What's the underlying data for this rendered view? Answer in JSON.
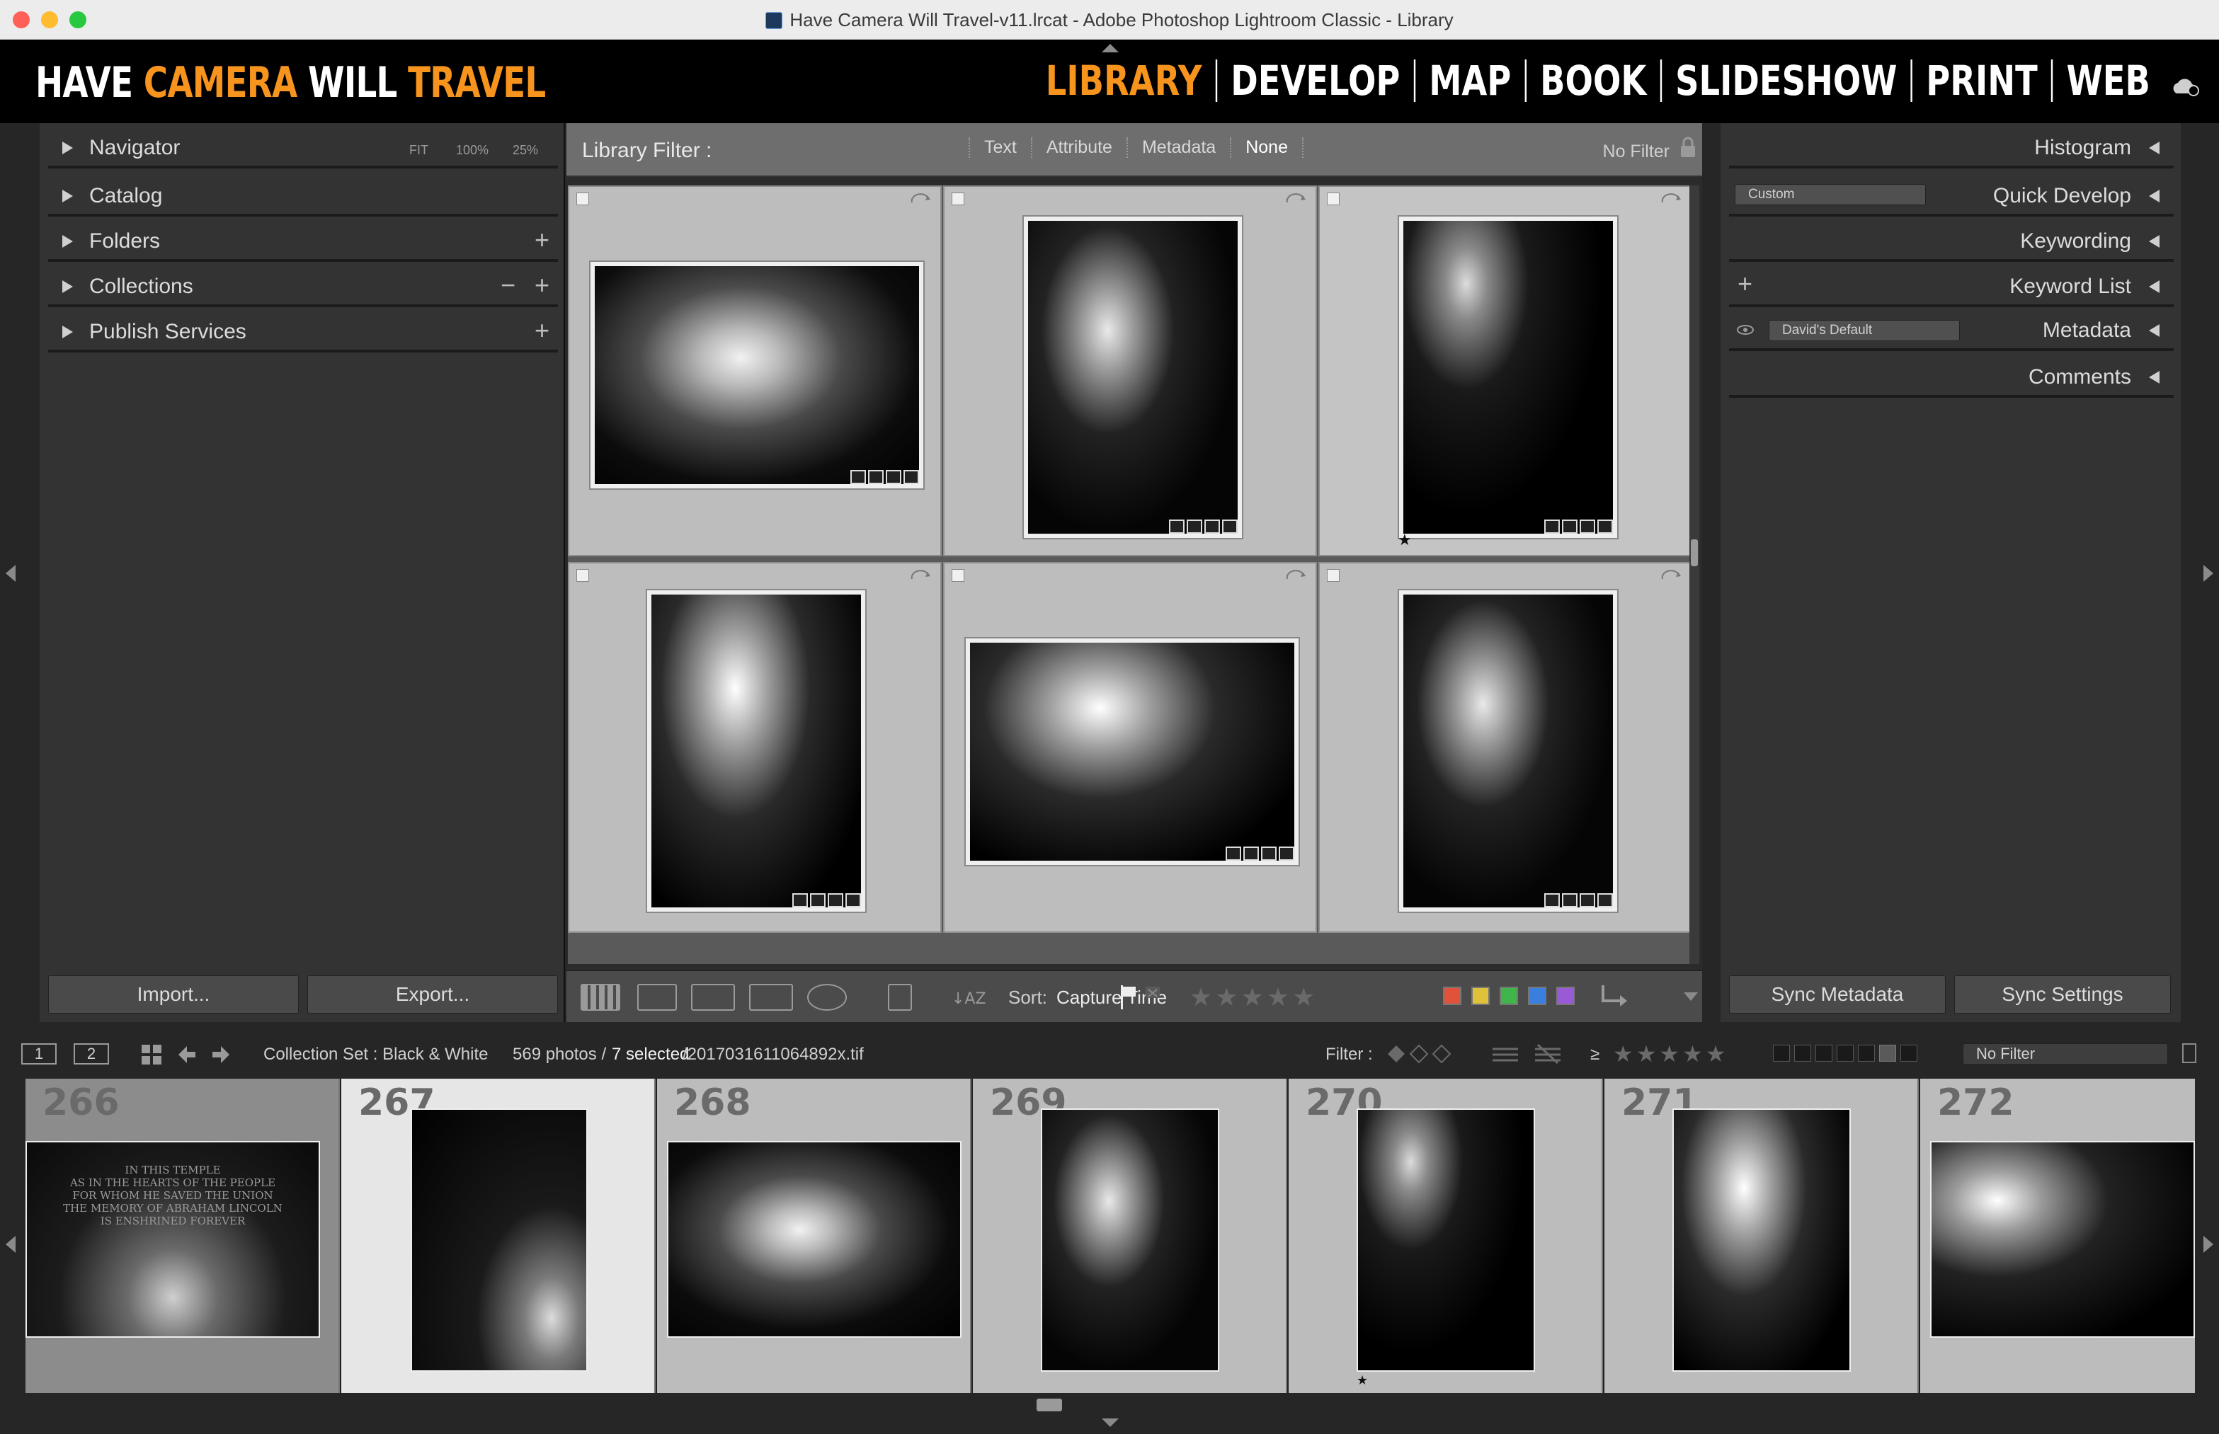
{
  "window": {
    "title": "Have Camera Will Travel-v11.lrcat - Adobe Photoshop Lightroom Classic - Library"
  },
  "identity": {
    "parts": [
      "HAVE",
      "CAMERA",
      "WILL",
      "TRAVEL"
    ]
  },
  "modules": [
    "LIBRARY",
    "DEVELOP",
    "MAP",
    "BOOK",
    "SLIDESHOW",
    "PRINT",
    "WEB"
  ],
  "active_module": "LIBRARY",
  "left_panel": {
    "navigator": {
      "label": "Navigator",
      "zoom": [
        "FIT",
        "100%",
        "25%"
      ]
    },
    "catalog": "Catalog",
    "folders": "Folders",
    "collections": "Collections",
    "publish_services": "Publish Services",
    "plus": "+",
    "minus": "−",
    "import_label": "Import...",
    "export_label": "Export..."
  },
  "filter_bar": {
    "label": "Library Filter :",
    "tabs": [
      "Text",
      "Attribute",
      "Metadata",
      "None"
    ],
    "selected_tab": "None",
    "preset": "No Filter"
  },
  "toolbar": {
    "sort_label": "Sort:",
    "sort_value": "Capture Time",
    "stars": "★★★★★",
    "colors": [
      "#e0533a",
      "#e0c23a",
      "#3fb54a",
      "#3a7fe0",
      "#9a5ad6"
    ]
  },
  "right_panel": {
    "histogram": "Histogram",
    "quick_develop": "Quick Develop",
    "quick_develop_preset": "Custom",
    "keywording": "Keywording",
    "keyword_list": "Keyword List",
    "metadata": "Metadata",
    "metadata_preset": "David's Default",
    "comments": "Comments",
    "sync_metadata": "Sync Metadata",
    "sync_settings": "Sync Settings"
  },
  "filmstrip_bar": {
    "monitor1": "1",
    "monitor2": "2",
    "source": "Collection Set : Black & White",
    "count": "569 photos /",
    "selected": "7 selected",
    "filename": "/2017031611064892x.tif",
    "filter_label": "Filter :",
    "gte": "≥",
    "stars": "★★★★★",
    "filter_preset": "No Filter"
  },
  "filmstrip": {
    "numbers": [
      "266",
      "267",
      "268",
      "269",
      "270",
      "271",
      "272"
    ],
    "inscription": [
      "IN THIS TEMPLE",
      "AS IN THE HEARTS OF THE PEOPLE",
      "FOR WHOM HE SAVED THE UNION",
      "THE MEMORY OF ABRAHAM LINCOLN",
      "IS ENSHRINED FOREVER"
    ]
  },
  "grid": {
    "star": "★",
    "star_count": 1
  }
}
